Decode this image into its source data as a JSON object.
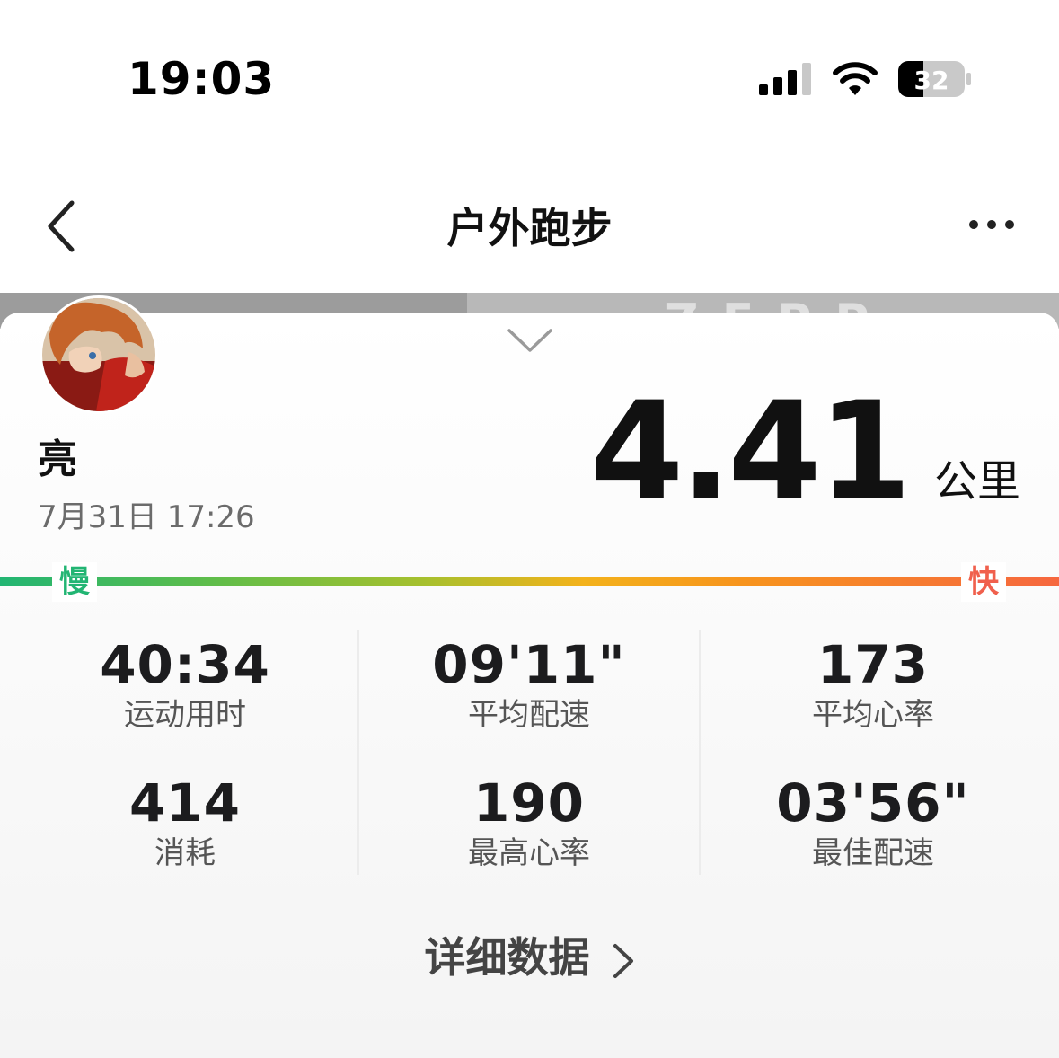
{
  "status_bar": {
    "time": "19:03",
    "battery_level": "32",
    "icons": [
      "signal-icon",
      "wifi-icon",
      "battery-icon"
    ]
  },
  "nav": {
    "title": "户外跑步",
    "back_icon": "chevron-left-icon",
    "more_icon": "more-horizontal-icon"
  },
  "map": {
    "watermark": "ZEPP LIFE"
  },
  "summary": {
    "username": "亮",
    "datetime": "7月31日 17:26",
    "distance_value": "4.41",
    "distance_unit": "公里"
  },
  "pace_legend": {
    "slow_label": "慢",
    "fast_label": "快",
    "slow_color": "#22b573",
    "fast_color": "#f0604d"
  },
  "stats": [
    {
      "value": "40:34",
      "label": "运动用时"
    },
    {
      "value": "09'11\"",
      "label": "平均配速"
    },
    {
      "value": "173",
      "label": "平均心率"
    },
    {
      "value": "414",
      "label": "消耗"
    },
    {
      "value": "190",
      "label": "最高心率"
    },
    {
      "value": "03'56\"",
      "label": "最佳配速"
    }
  ],
  "detail_link": {
    "label": "详细数据"
  }
}
